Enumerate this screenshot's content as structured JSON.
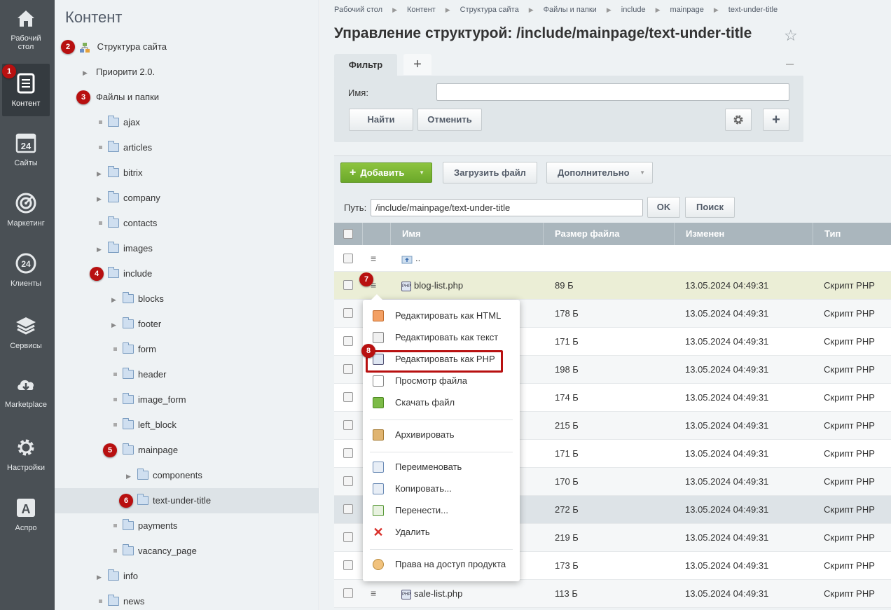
{
  "rail": {
    "items": [
      {
        "label": "Рабочий стол",
        "icon": "home-icon"
      },
      {
        "label": "Контент",
        "icon": "document-icon"
      },
      {
        "label": "Сайты",
        "icon": "calendar-24-icon"
      },
      {
        "label": "Маркетинг",
        "icon": "target-icon"
      },
      {
        "label": "Клиенты",
        "icon": "clients-24-icon"
      },
      {
        "label": "Сервисы",
        "icon": "layers-icon"
      },
      {
        "label": "Marketplace",
        "icon": "cloud-download-icon"
      },
      {
        "label": "Настройки",
        "icon": "gear-icon"
      },
      {
        "label": "Аспро",
        "icon": "aspro-a-icon"
      }
    ],
    "badge": "1"
  },
  "tree": {
    "title": "Контент",
    "badges": [
      "2",
      "3",
      "4",
      "5",
      "6"
    ],
    "nodes": [
      {
        "label": "Структура сайта"
      },
      {
        "label": "Приорити 2.0."
      },
      {
        "label": "Файлы и папки"
      },
      {
        "label": "ajax"
      },
      {
        "label": "articles"
      },
      {
        "label": "bitrix"
      },
      {
        "label": "company"
      },
      {
        "label": "contacts"
      },
      {
        "label": "images"
      },
      {
        "label": "include"
      },
      {
        "label": "blocks"
      },
      {
        "label": "footer"
      },
      {
        "label": "form"
      },
      {
        "label": "header"
      },
      {
        "label": "image_form"
      },
      {
        "label": "left_block"
      },
      {
        "label": "mainpage"
      },
      {
        "label": "components"
      },
      {
        "label": "text-under-title"
      },
      {
        "label": "payments"
      },
      {
        "label": "vacancy_page"
      },
      {
        "label": "info"
      },
      {
        "label": "news"
      }
    ]
  },
  "breadcrumbs": [
    "Рабочий стол",
    "Контент",
    "Структура сайта",
    "Файлы и папки",
    "include",
    "mainpage",
    "text-under-title"
  ],
  "page_title": "Управление структурой: /include/mainpage/text-under-title",
  "filter": {
    "tab": "Фильтр",
    "add_tab": "+",
    "minimize": "–",
    "name_label": "Имя:",
    "name_value": "",
    "find": "Найти",
    "cancel": "Отменить",
    "plus": "+"
  },
  "toolbar": {
    "add": "Добавить",
    "upload": "Загрузить файл",
    "more": "Дополнительно",
    "path_label": "Путь:",
    "path_value": "/include/mainpage/text-under-title",
    "ok": "OK",
    "search": "Поиск"
  },
  "table": {
    "headers": [
      "Имя",
      "Размер файла",
      "Изменен",
      "Тип"
    ],
    "up_row": "..",
    "rows": [
      {
        "name": "blog-list.php",
        "size": "89 Б",
        "date": "13.05.2024 04:49:31",
        "type": "Скрипт PHP"
      },
      {
        "name": "",
        "size": "178 Б",
        "date": "13.05.2024 04:49:31",
        "type": "Скрипт PHP"
      },
      {
        "name": "",
        "size": "171 Б",
        "date": "13.05.2024 04:49:31",
        "type": "Скрипт PHP"
      },
      {
        "name": "",
        "size": "198 Б",
        "date": "13.05.2024 04:49:31",
        "type": "Скрипт PHP"
      },
      {
        "name": "",
        "size": "174 Б",
        "date": "13.05.2024 04:49:31",
        "type": "Скрипт PHP"
      },
      {
        "name": "",
        "size": "215 Б",
        "date": "13.05.2024 04:49:31",
        "type": "Скрипт PHP"
      },
      {
        "name": "",
        "size": "171 Б",
        "date": "13.05.2024 04:49:31",
        "type": "Скрипт PHP"
      },
      {
        "name": "",
        "size": "170 Б",
        "date": "13.05.2024 04:49:31",
        "type": "Скрипт PHP"
      },
      {
        "name": "",
        "size": "272 Б",
        "date": "13.05.2024 04:49:31",
        "type": "Скрипт PHP"
      },
      {
        "name": "",
        "size": "219 Б",
        "date": "13.05.2024 04:49:31",
        "type": "Скрипт PHP"
      },
      {
        "name": "",
        "size": "173 Б",
        "date": "13.05.2024 04:49:31",
        "type": "Скрипт PHP"
      },
      {
        "name": "sale-list.php",
        "size": "113 Б",
        "date": "13.05.2024 04:49:31",
        "type": "Скрипт PHP"
      }
    ],
    "row_badge": "7"
  },
  "context_menu": {
    "badge": "8",
    "items": [
      {
        "label": "Редактировать как HTML",
        "icon": "html-edit-icon"
      },
      {
        "label": "Редактировать как текст",
        "icon": "txt-edit-icon"
      },
      {
        "label": "Редактировать как PHP",
        "icon": "php-edit-icon"
      },
      {
        "label": "Просмотр файла",
        "icon": "view-file-icon"
      },
      {
        "label": "Скачать файл",
        "icon": "download-file-icon"
      },
      {
        "label": "Архивировать",
        "icon": "archive-icon"
      },
      {
        "label": "Переименовать",
        "icon": "rename-icon"
      },
      {
        "label": "Копировать...",
        "icon": "copy-icon"
      },
      {
        "label": "Перенести...",
        "icon": "move-icon"
      },
      {
        "label": "Удалить",
        "icon": "delete-icon"
      },
      {
        "label": "Права на доступ продукта",
        "icon": "access-rights-icon"
      }
    ]
  }
}
